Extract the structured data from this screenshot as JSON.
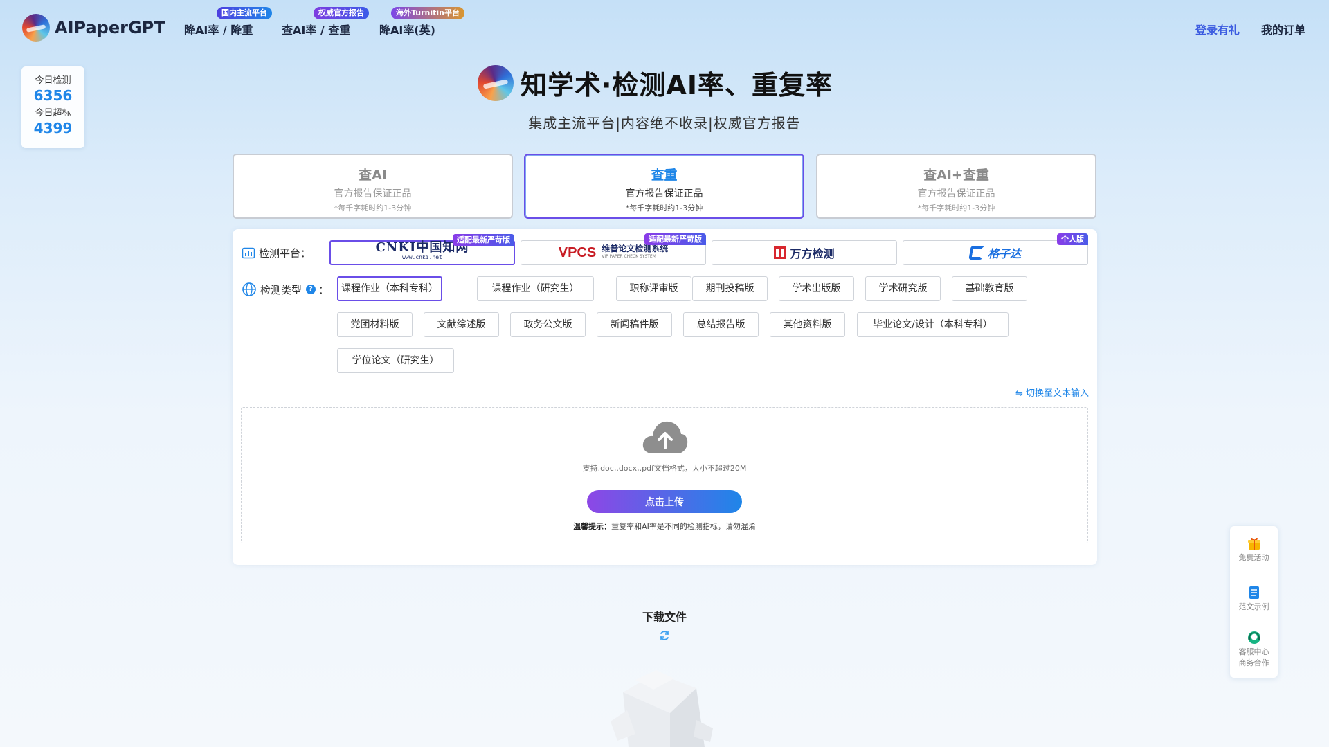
{
  "brand": {
    "name": "AIPaperGPT"
  },
  "nav": {
    "items": [
      {
        "label": "降AI率 / 降重",
        "badge": "国内主流平台"
      },
      {
        "label": "查AI率 / 查重",
        "badge": "权威官方报告"
      },
      {
        "label": "降AI率(英)",
        "badge": "海外Turnitin平台"
      }
    ],
    "login": "登录有礼",
    "orders": "我的订单"
  },
  "stats": {
    "today_checks_label": "今日检测",
    "today_checks": "6356",
    "today_over_label": "今日超标",
    "today_over": "4399"
  },
  "hero": {
    "title": "知学术·检测AI率、重复率",
    "subtitle": "集成主流平台|内容绝不收录|权威官方报告"
  },
  "modes": [
    {
      "title": "查AI",
      "sub": "官方报告保证正品",
      "note": "*每千字耗时约1-3分钟",
      "active": false
    },
    {
      "title": "查重",
      "sub": "官方报告保证正品",
      "note": "*每千字耗时约1-3分钟",
      "active": true
    },
    {
      "title": "查AI+查重",
      "sub": "官方报告保证正品",
      "note": "*每千字耗时约1-3分钟",
      "active": false
    }
  ],
  "platform": {
    "label": "检测平台：",
    "items": [
      {
        "name": "cnki",
        "logo_text": "CNKI中国知网",
        "logo_sub": "www.cnki.net",
        "badge": "适配最新严苛版",
        "active": true
      },
      {
        "name": "vpcs",
        "logo_text": "VPCS",
        "logo_sub": "维普论文检测系统",
        "logo_tiny": "VIP PAPER CHECK SYSTEM",
        "badge": "适配最新严苛版",
        "active": false
      },
      {
        "name": "wanfang",
        "logo_text": "万方检测",
        "badge": "",
        "active": false
      },
      {
        "name": "gezida",
        "logo_text": "格子达",
        "badge": "个人版",
        "active": false
      }
    ]
  },
  "check_type": {
    "label": "检测类型",
    "help": "?",
    "colon": "：",
    "options": [
      "课程作业（本科专科）",
      "课程作业（研究生）",
      "职称评审版",
      "期刊投稿版",
      "学术出版版",
      "学术研究版",
      "基础教育版",
      "党团材料版",
      "文献综述版",
      "政务公文版",
      "新闻稿件版",
      "总结报告版",
      "其他资料版",
      "毕业论文/设计（本科专科）",
      "学位论文（研究生）"
    ],
    "selected": "课程作业（本科专科）"
  },
  "upload": {
    "switch_text": "切换至文本输入",
    "switch_icon": "swap-arrows-icon",
    "hint": "支持.doc,.docx,.pdf文档格式，大小不超过20M",
    "button": "点击上传",
    "tip_label": "温馨提示：",
    "tip_text": "重复率和AI率是不同的检测指标，请勿混淆"
  },
  "download": {
    "title": "下载文件"
  },
  "side": {
    "items": [
      {
        "label": "免费活动",
        "icon": "gift-icon"
      },
      {
        "label": "范文示例",
        "icon": "document-icon"
      },
      {
        "label": "客服中心",
        "label2": "商务合作",
        "icon": "customer-service-icon"
      }
    ]
  },
  "colors": {
    "accent": "#1f86e8",
    "active_border": "#6a4ee8",
    "upload_gradient_start": "#8d47e6"
  }
}
